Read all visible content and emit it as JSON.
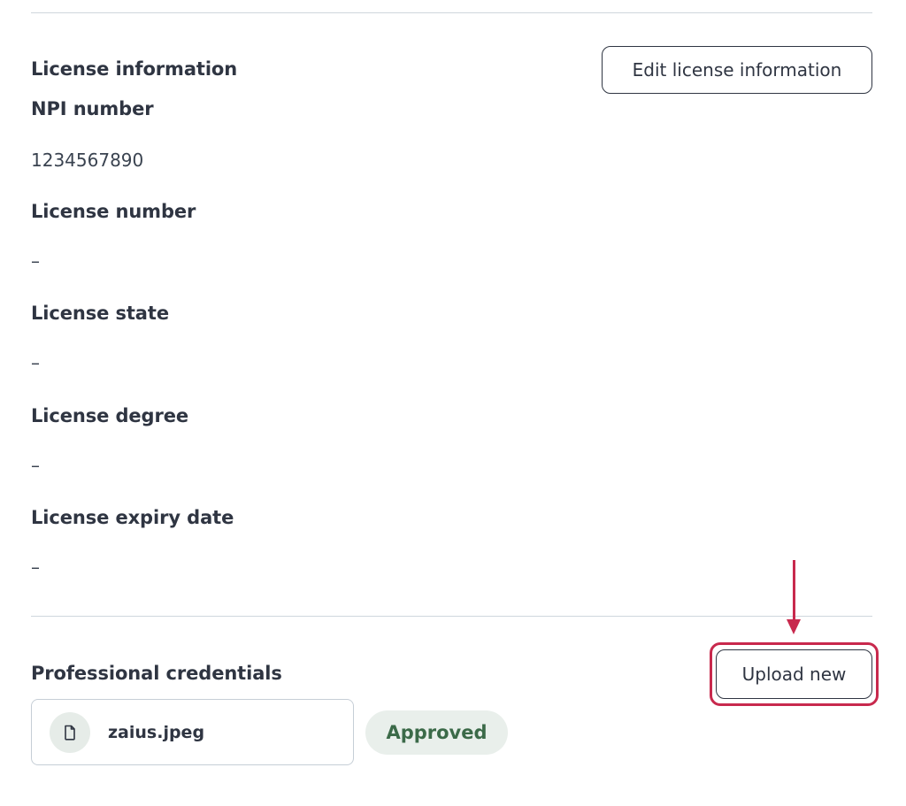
{
  "license": {
    "section_title": "License information",
    "edit_button_label": "Edit license information",
    "fields": [
      {
        "label": "NPI number",
        "value": "1234567890"
      },
      {
        "label": "License number",
        "value": "–"
      },
      {
        "label": "License state",
        "value": "–"
      },
      {
        "label": "License degree",
        "value": "–"
      },
      {
        "label": "License expiry date",
        "value": "–"
      }
    ]
  },
  "credentials": {
    "section_title": "Professional credentials",
    "upload_button_label": "Upload new",
    "file": {
      "name": "zaius.jpeg",
      "icon": "file-icon",
      "status": "Approved"
    }
  },
  "colors": {
    "annotation": "#c8294d",
    "badge_text": "#3b6a48",
    "badge_bg": "#e9efeb"
  }
}
